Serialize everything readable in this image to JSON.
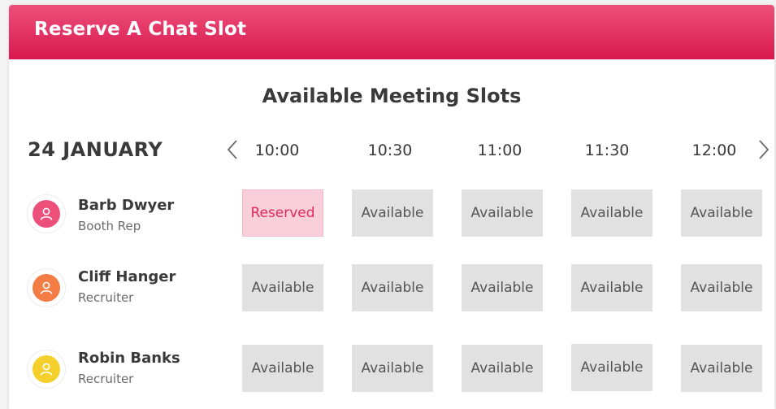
{
  "header": {
    "title": "Reserve A Chat Slot"
  },
  "section_title": "Available Meeting Slots",
  "date_label": "24 JANUARY",
  "nav": {
    "prev_icon": "chevron-left-icon",
    "next_icon": "chevron-right-icon"
  },
  "times": [
    "10:00",
    "10:30",
    "11:00",
    "11:30",
    "12:00"
  ],
  "colors": {
    "brand": "#e0285c",
    "reserved_bg": "#f9cfd9",
    "available_bg": "#e1e1e1",
    "avatar_pink": "#ec4f7a",
    "avatar_orange": "#f47c45",
    "avatar_yellow": "#f5cf2b"
  },
  "people": [
    {
      "name": "Barb Dwyer",
      "role": "Booth Rep",
      "avatar_color": "#ec4f7a",
      "avatar_icon": "user-icon",
      "slots": [
        "Reserved",
        "Available",
        "Available",
        "Available",
        "Available"
      ]
    },
    {
      "name": "Cliff Hanger",
      "role": "Recruiter",
      "avatar_color": "#f47c45",
      "avatar_icon": "user-icon",
      "slots": [
        "Available",
        "Available",
        "Available",
        "Available",
        "Available"
      ]
    },
    {
      "name": "Robin Banks",
      "role": "Recruiter",
      "avatar_color": "#f5cf2b",
      "avatar_icon": "user-icon",
      "slots": [
        "Available",
        "Available",
        "Available",
        "Available",
        "Available"
      ]
    }
  ]
}
